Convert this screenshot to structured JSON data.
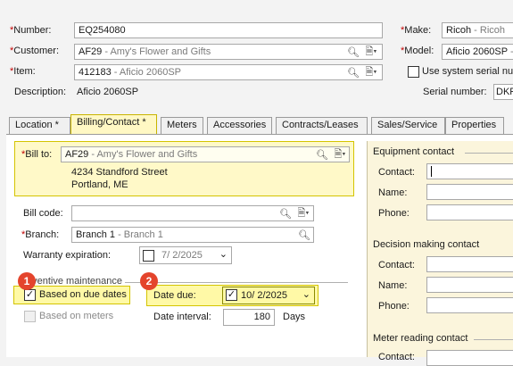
{
  "header": {
    "number_label": "*Number:",
    "number_value": "EQ254080",
    "customer_label": "*Customer:",
    "customer_code": "AF29",
    "customer_name": " - Amy's Flower and Gifts",
    "item_label": "*Item:",
    "item_code": "412183",
    "item_name": " - Aficio 2060SP",
    "description_label": "Description:",
    "description_value": "Aficio 2060SP",
    "make_label": "*Make:",
    "make_code": "Ricoh",
    "make_name": " - Ricoh",
    "model_label": "*Model:",
    "model_code": "Aficio 2060SP",
    "model_name": " - A",
    "system_serial_label": "Use system serial num",
    "serial_label": "Serial number:",
    "serial_value": "DKF"
  },
  "tabs": [
    {
      "label": "Location *"
    },
    {
      "label": "Billing/Contact *"
    },
    {
      "label": "Meters"
    },
    {
      "label": "Accessories"
    },
    {
      "label": "Contracts/Leases"
    },
    {
      "label": "Sales/Service"
    },
    {
      "label": "Properties"
    }
  ],
  "billing": {
    "bill_to_label": "*Bill to:",
    "bill_to_code": "AF29",
    "bill_to_name": " - Amy's Flower and Gifts",
    "address_line1": "4234 Standford Street",
    "address_line2": "Portland, ME",
    "bill_code_label": "Bill code:",
    "bill_code_value": "",
    "branch_label": "*Branch:",
    "branch_code": "Branch 1",
    "branch_name": " - Branch 1",
    "warranty_label": "Warranty expiration:",
    "warranty_value": "7/ 2/2025"
  },
  "preventive": {
    "group_label": "eventive maintenance",
    "due_dates_label": "Based on due dates",
    "due_dates_checked": true,
    "meters_label": "Based on meters",
    "meters_checked": false,
    "date_due_label": "Date due:",
    "date_due_value": "10/ 2/2025",
    "date_interval_label": "Date interval:",
    "date_interval_value": "180",
    "days_label": "Days"
  },
  "badges": [
    "1",
    "2"
  ],
  "contacts": {
    "equipment_title": "Equipment contact",
    "decision_title": "Decision making contact",
    "meter_title": "Meter reading contact",
    "contact_label": "Contact:",
    "name_label": "Name:",
    "phone_label": "Phone:"
  },
  "colors": {
    "required": "#c00000",
    "highlight": "#fff9a6",
    "badge": "#e4442c"
  }
}
